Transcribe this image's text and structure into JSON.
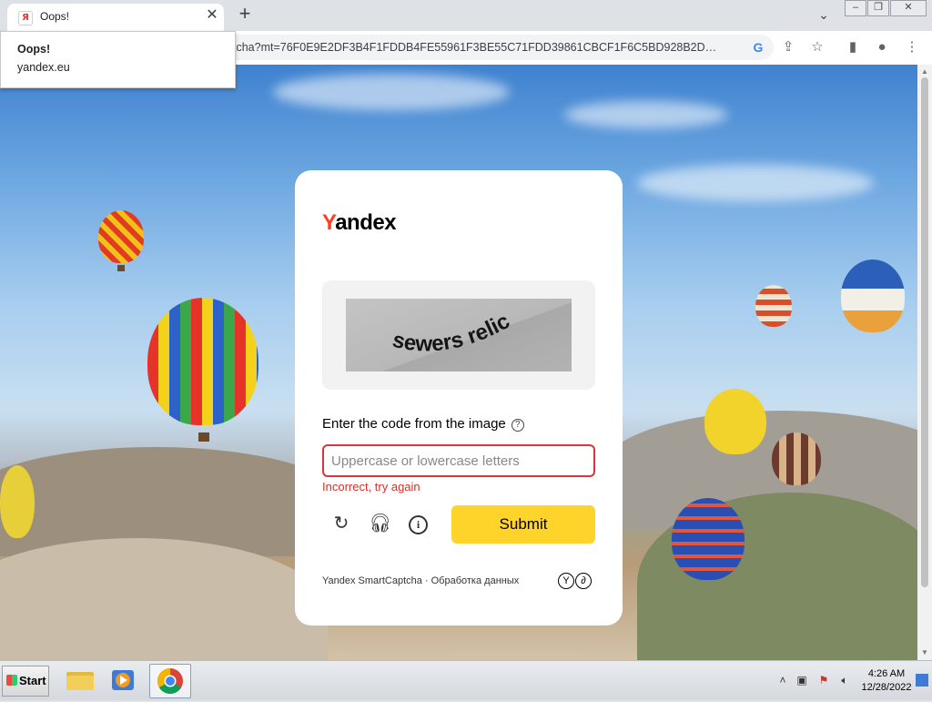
{
  "browser": {
    "tab_title": "Oops!",
    "tab_favicon": "Я",
    "url": "tcha?mt=76F0E9E2DF3B4F1FDDB4FE55961F3BE55C71FDD39861CBCF1F6C5BD928B2D…",
    "hover_card": {
      "title": "Oops!",
      "host": "yandex.eu"
    }
  },
  "captcha": {
    "logo_first": "Y",
    "logo_rest": "andex",
    "captcha_text": "sewers relic",
    "prompt": "Enter the code from the image",
    "help_icon": "question-circle-icon",
    "input_placeholder": "Uppercase or lowercase letters",
    "input_value": "",
    "error": "Incorrect, try again",
    "submit_label": "Submit",
    "footer": "Yandex SmartCaptcha · Обработка данных",
    "footer_marks": [
      "Y",
      "∂"
    ],
    "colors": {
      "submit": "#fed42b",
      "error": "#d93027",
      "logo_accent": "#fc3f1d"
    }
  },
  "taskbar": {
    "start_label": "Start",
    "time": "4:26 AM",
    "date": "12/28/2022"
  }
}
